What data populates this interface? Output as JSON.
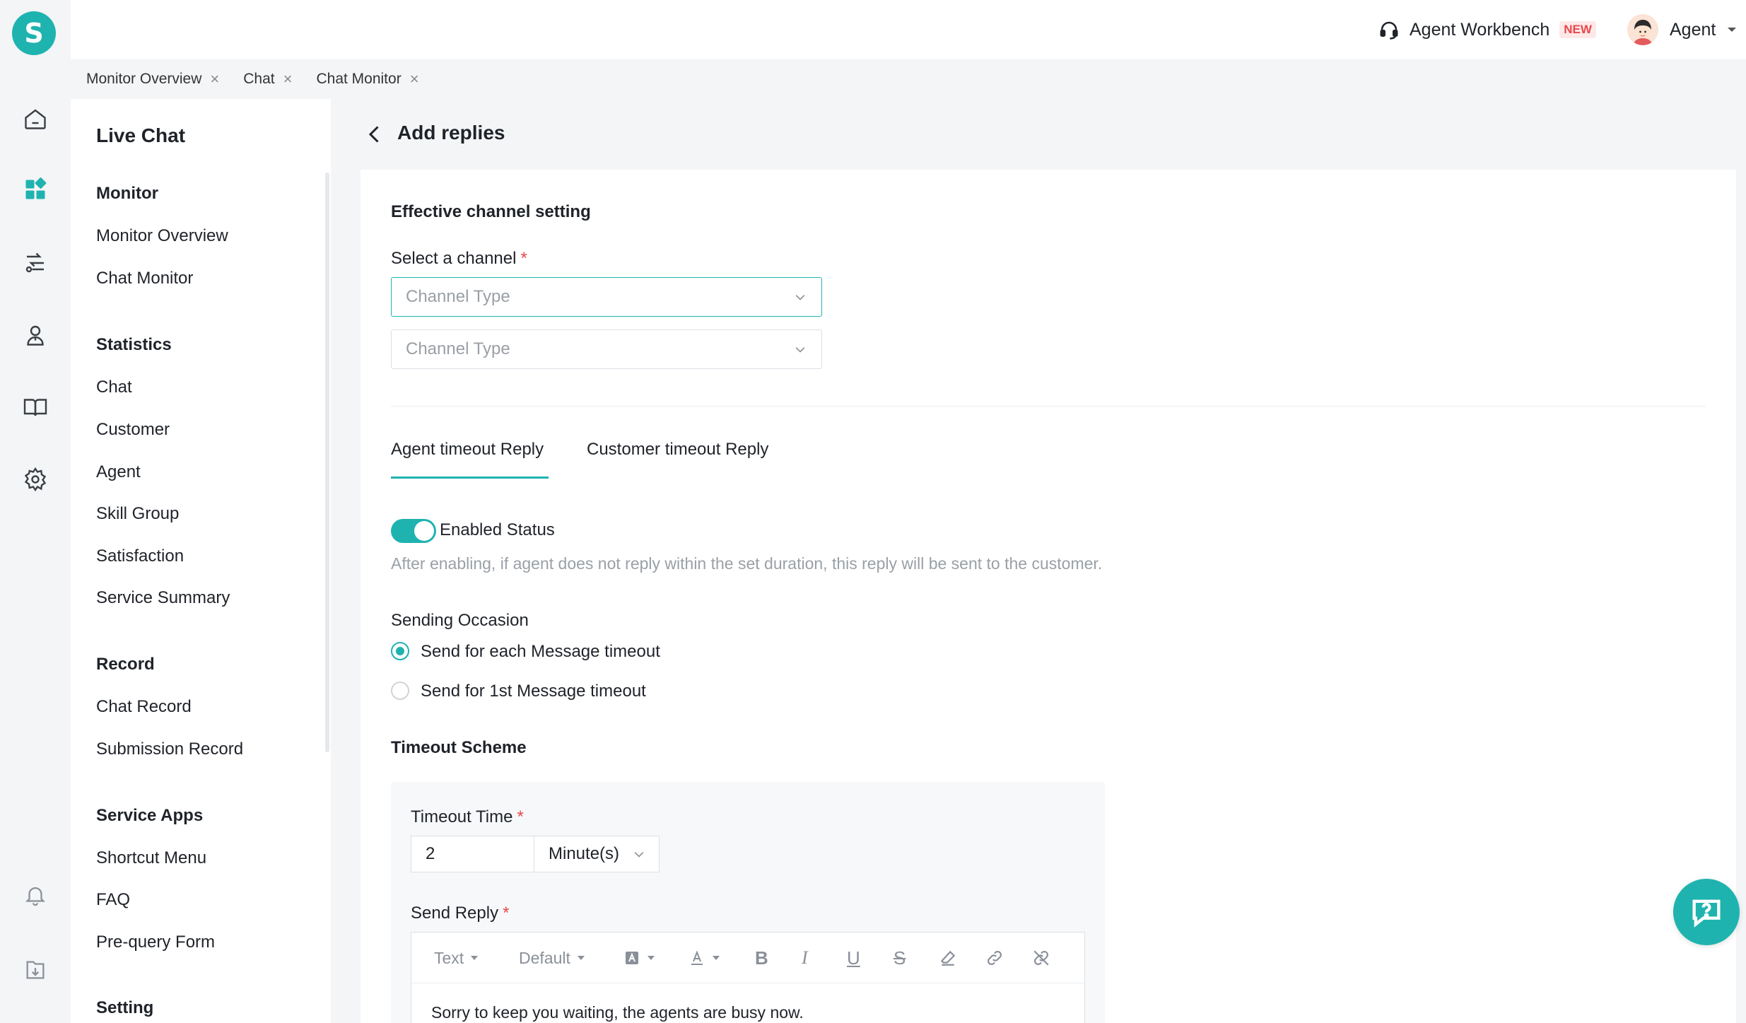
{
  "app": {
    "logo_letter": "S",
    "accent": "#1fb3b0",
    "danger": "#e8484b"
  },
  "rail": {
    "icons": [
      "home-icon",
      "dashboard-icon",
      "routing-icon",
      "agent-icon",
      "book-icon",
      "settings-icon",
      "bell-icon",
      "download-icon"
    ]
  },
  "header": {
    "workbench_label": "Agent Workbench",
    "workbench_badge": "NEW",
    "user_name": "Agent"
  },
  "tabs": [
    {
      "label": "Monitor Overview"
    },
    {
      "label": "Chat"
    },
    {
      "label": "Chat Monitor"
    }
  ],
  "sidebar": {
    "title": "Live Chat",
    "groups": [
      {
        "label": "Monitor",
        "items": [
          "Monitor Overview",
          "Chat Monitor"
        ]
      },
      {
        "label": "Statistics",
        "items": [
          "Chat",
          "Customer",
          "Agent",
          "Skill Group",
          "Satisfaction",
          "Service Summary"
        ]
      },
      {
        "label": "Record",
        "items": [
          "Chat Record",
          "Submission Record"
        ]
      },
      {
        "label": "Service Apps",
        "items": [
          "Shortcut Menu",
          "FAQ",
          "Pre-query Form"
        ]
      },
      {
        "label": "Setting",
        "items": []
      }
    ]
  },
  "page": {
    "title": "Add replies",
    "section_channel": "Effective channel setting",
    "select_channel_label": "Select a channel",
    "required_mark": "*",
    "channel_select_1_placeholder": "Channel Type",
    "channel_select_2_placeholder": "Channel Type",
    "reply_tabs": [
      {
        "label": "Agent timeout Reply",
        "active": true
      },
      {
        "label": "Customer timeout Reply",
        "active": false
      }
    ],
    "enabled_label": "Enabled Status",
    "enabled": true,
    "enabled_hint": "After enabling, if agent does not reply within the set duration, this reply will be sent to the customer.",
    "sending_occasion_label": "Sending Occasion",
    "occasion_options": [
      {
        "label": "Send for each Message timeout",
        "selected": true
      },
      {
        "label": "Send for 1st Message timeout",
        "selected": false
      }
    ],
    "timeout_scheme_label": "Timeout Scheme",
    "timeout_time_label": "Timeout Time",
    "timeout_value": "2",
    "timeout_unit": "Minute(s)",
    "send_reply_label": "Send Reply",
    "editor": {
      "text_style": "Text",
      "font_default": "Default",
      "reply_text": "Sorry to keep you waiting, the agents are busy now."
    }
  }
}
